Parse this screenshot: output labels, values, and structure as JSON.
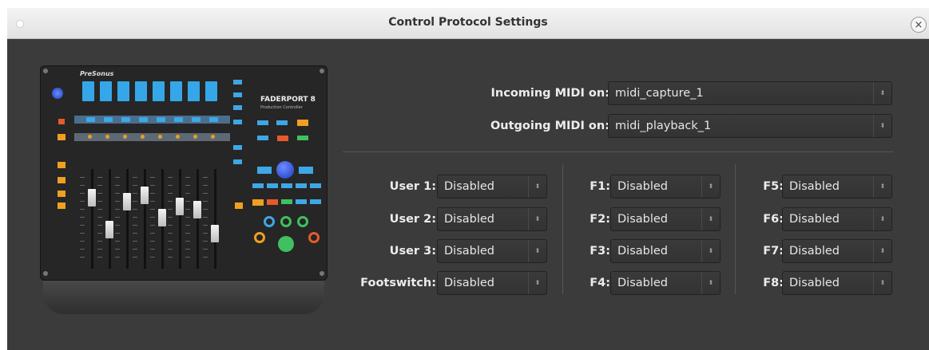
{
  "window": {
    "title": "Control Protocol Settings",
    "close_glyph": "×"
  },
  "device": {
    "brand": "PreSonus",
    "model": "FADERPORT 8",
    "model_sub": "Production Controller"
  },
  "midi": {
    "incoming_label": "Incoming MIDI on:",
    "incoming_value": "midi_capture_1",
    "outgoing_label": "Outgoing MIDI on:",
    "outgoing_value": "midi_playback_1"
  },
  "buttons_col1": [
    {
      "label": "User 1:",
      "value": "Disabled"
    },
    {
      "label": "User 2:",
      "value": "Disabled"
    },
    {
      "label": "User 3:",
      "value": "Disabled"
    },
    {
      "label": "Footswitch:",
      "value": "Disabled"
    }
  ],
  "buttons_col2": [
    {
      "label": "F1:",
      "value": "Disabled"
    },
    {
      "label": "F2:",
      "value": "Disabled"
    },
    {
      "label": "F3:",
      "value": "Disabled"
    },
    {
      "label": "F4:",
      "value": "Disabled"
    }
  ],
  "buttons_col3": [
    {
      "label": "F5:",
      "value": "Disabled"
    },
    {
      "label": "F6:",
      "value": "Disabled"
    },
    {
      "label": "F7:",
      "value": "Disabled"
    },
    {
      "label": "F8:",
      "value": "Disabled"
    }
  ],
  "icons": {
    "combo_arrow": "⬍"
  },
  "colors": {
    "background": "#3b3b3b",
    "label": "#ececec",
    "device_lcd": "#35a7e8"
  }
}
